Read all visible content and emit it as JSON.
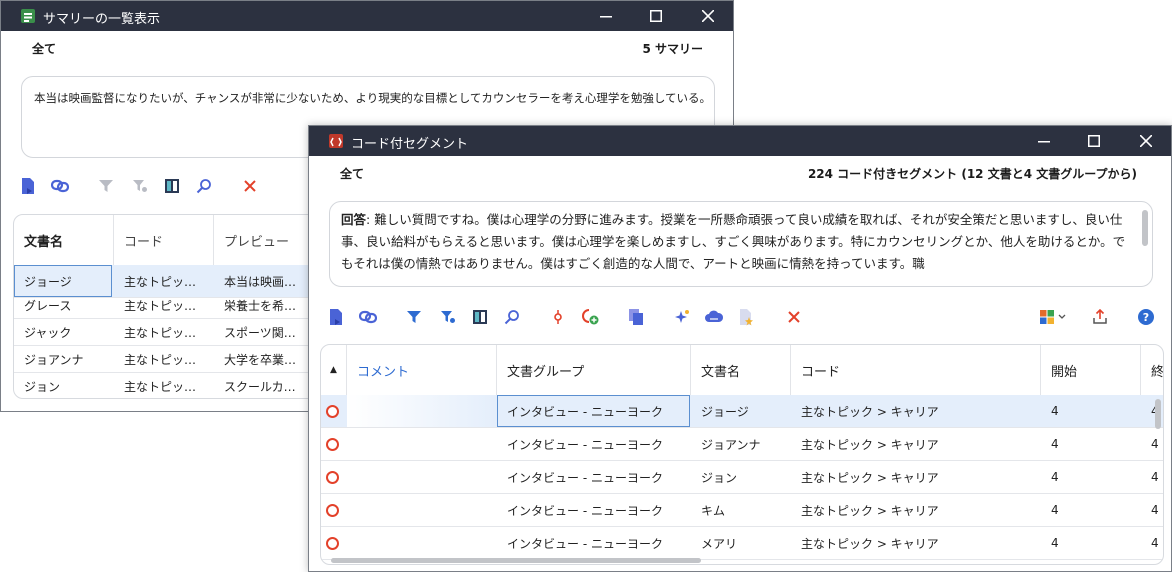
{
  "colors": {
    "titlebar": "#2c3140",
    "accent": "#2e6bd1",
    "red": "#e3412a",
    "selection": "#e4eefb"
  },
  "summary_window": {
    "title": "サマリーの一覧表示",
    "filter_label": "全て",
    "count_label": "5 サマリー",
    "summary_text": "本当は映画監督になりたいが、チャンスが非常に少ないため、より現実的な目標としてカウンセラーを考え心理学を勉強している。",
    "toolbar_icons": [
      "document-export-icon",
      "link-icon",
      "filter-icon",
      "filter-settings-icon",
      "columns-icon",
      "search-icon",
      "delete-icon"
    ],
    "columns": [
      "文書名",
      "コード",
      "プレビュー"
    ],
    "rows": [
      {
        "doc": "ジョージ",
        "code": "主なトピッ…",
        "preview": "本当は映画…"
      },
      {
        "doc": "グレース",
        "code": "主なトピッ…",
        "preview": "栄養士を希…"
      },
      {
        "doc": "ジャック",
        "code": "主なトピッ…",
        "preview": "スポーツ関…"
      },
      {
        "doc": "ジョアンナ",
        "code": "主なトピッ…",
        "preview": "大学を卒業…"
      },
      {
        "doc": "ジョン",
        "code": "主なトピッ…",
        "preview": "スクールカ…"
      }
    ]
  },
  "segment_window": {
    "title": "コード付セグメント",
    "filter_label": "全て",
    "count_label": "224 コード付きセグメント (12 文書と4 文書グループから)",
    "answer_label": "回答",
    "answer_text": ": 難しい質問ですね。僕は心理学の分野に進みます。授業を一所懸命頑張って良い成績を取れば、それが安全策だと思いますし、良い仕事、良い給料がもらえると思います。僕は心理学を楽しめますし、すごく興味があります。特にカウンセリングとか、他人を助けるとか。でもそれは僕の情熱ではありません。僕はすごく創造的な人間で、アートと映画に情熱を持っています。職",
    "columns": [
      "コメント",
      "文書グループ",
      "文書名",
      "コード",
      "開始",
      "終"
    ],
    "sort_indicator": "▲",
    "rows": [
      {
        "group": "インタビュー - ニューヨーク",
        "doc": "ジョージ",
        "code": "主なトピック > キャリア",
        "start": "4",
        "end": "4"
      },
      {
        "group": "インタビュー - ニューヨーク",
        "doc": "ジョアンナ",
        "code": "主なトピック > キャリア",
        "start": "4",
        "end": "4"
      },
      {
        "group": "インタビュー - ニューヨーク",
        "doc": "ジョン",
        "code": "主なトピック > キャリア",
        "start": "4",
        "end": "4"
      },
      {
        "group": "インタビュー - ニューヨーク",
        "doc": "キム",
        "code": "主なトピック > キャリア",
        "start": "4",
        "end": "4"
      },
      {
        "group": "インタビュー - ニューヨーク",
        "doc": "メアリ",
        "code": "主なトピック > キャリア",
        "start": "4",
        "end": "4"
      }
    ]
  }
}
